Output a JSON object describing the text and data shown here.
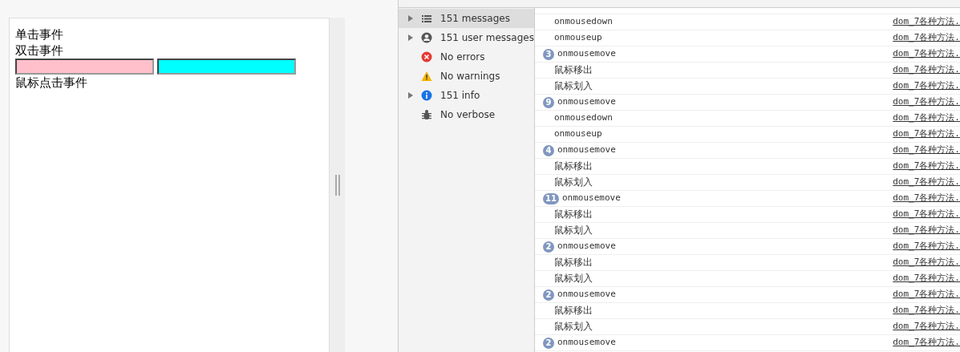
{
  "page": {
    "lines_top": [
      "单击事件",
      "双击事件"
    ],
    "inputs": [
      {
        "color": "#ffc0cb"
      },
      {
        "color": "#00ffff"
      }
    ],
    "lines_bottom": [
      "鼠标点击事件"
    ]
  },
  "sidebar": {
    "items": [
      {
        "label": "151 messages",
        "kind": "list",
        "expandable": true,
        "selected": true
      },
      {
        "label": "151 user messages",
        "kind": "user",
        "expandable": true,
        "selected": false
      },
      {
        "label": "No errors",
        "kind": "error",
        "expandable": false,
        "selected": false
      },
      {
        "label": "No warnings",
        "kind": "warning",
        "expandable": false,
        "selected": false
      },
      {
        "label": "151 info",
        "kind": "info",
        "expandable": true,
        "selected": false
      },
      {
        "label": "No verbose",
        "kind": "verbose",
        "expandable": false,
        "selected": false
      }
    ]
  },
  "log": [
    {
      "text": "onmousedown",
      "source": "dom_7各种方法."
    },
    {
      "text": "onmouseup",
      "source": "dom_7各种方法."
    },
    {
      "count": "3",
      "text": "onmousemove",
      "source": "dom_7各种方法."
    },
    {
      "text": "鼠标移出",
      "source": "dom_7各种方法."
    },
    {
      "text": "鼠标划入",
      "source": "dom_7各种方法."
    },
    {
      "count": "9",
      "text": "onmousemove",
      "source": "dom_7各种方法."
    },
    {
      "text": "onmousedown",
      "source": "dom_7各种方法."
    },
    {
      "text": "onmouseup",
      "source": "dom_7各种方法."
    },
    {
      "count": "4",
      "text": "onmousemove",
      "source": "dom_7各种方法."
    },
    {
      "text": "鼠标移出",
      "source": "dom_7各种方法."
    },
    {
      "text": "鼠标划入",
      "source": "dom_7各种方法."
    },
    {
      "count": "11",
      "text": "onmousemove",
      "source": "dom_7各种方法."
    },
    {
      "text": "鼠标移出",
      "source": "dom_7各种方法."
    },
    {
      "text": "鼠标划入",
      "source": "dom_7各种方法."
    },
    {
      "count": "2",
      "text": "onmousemove",
      "source": "dom_7各种方法."
    },
    {
      "text": "鼠标移出",
      "source": "dom_7各种方法."
    },
    {
      "text": "鼠标划入",
      "source": "dom_7各种方法."
    },
    {
      "count": "2",
      "text": "onmousemove",
      "source": "dom_7各种方法."
    },
    {
      "text": "鼠标移出",
      "source": "dom_7各种方法."
    },
    {
      "text": "鼠标划入",
      "source": "dom_7各种方法."
    },
    {
      "count": "2",
      "text": "onmousemove",
      "source": "dom_7各种方法."
    }
  ]
}
